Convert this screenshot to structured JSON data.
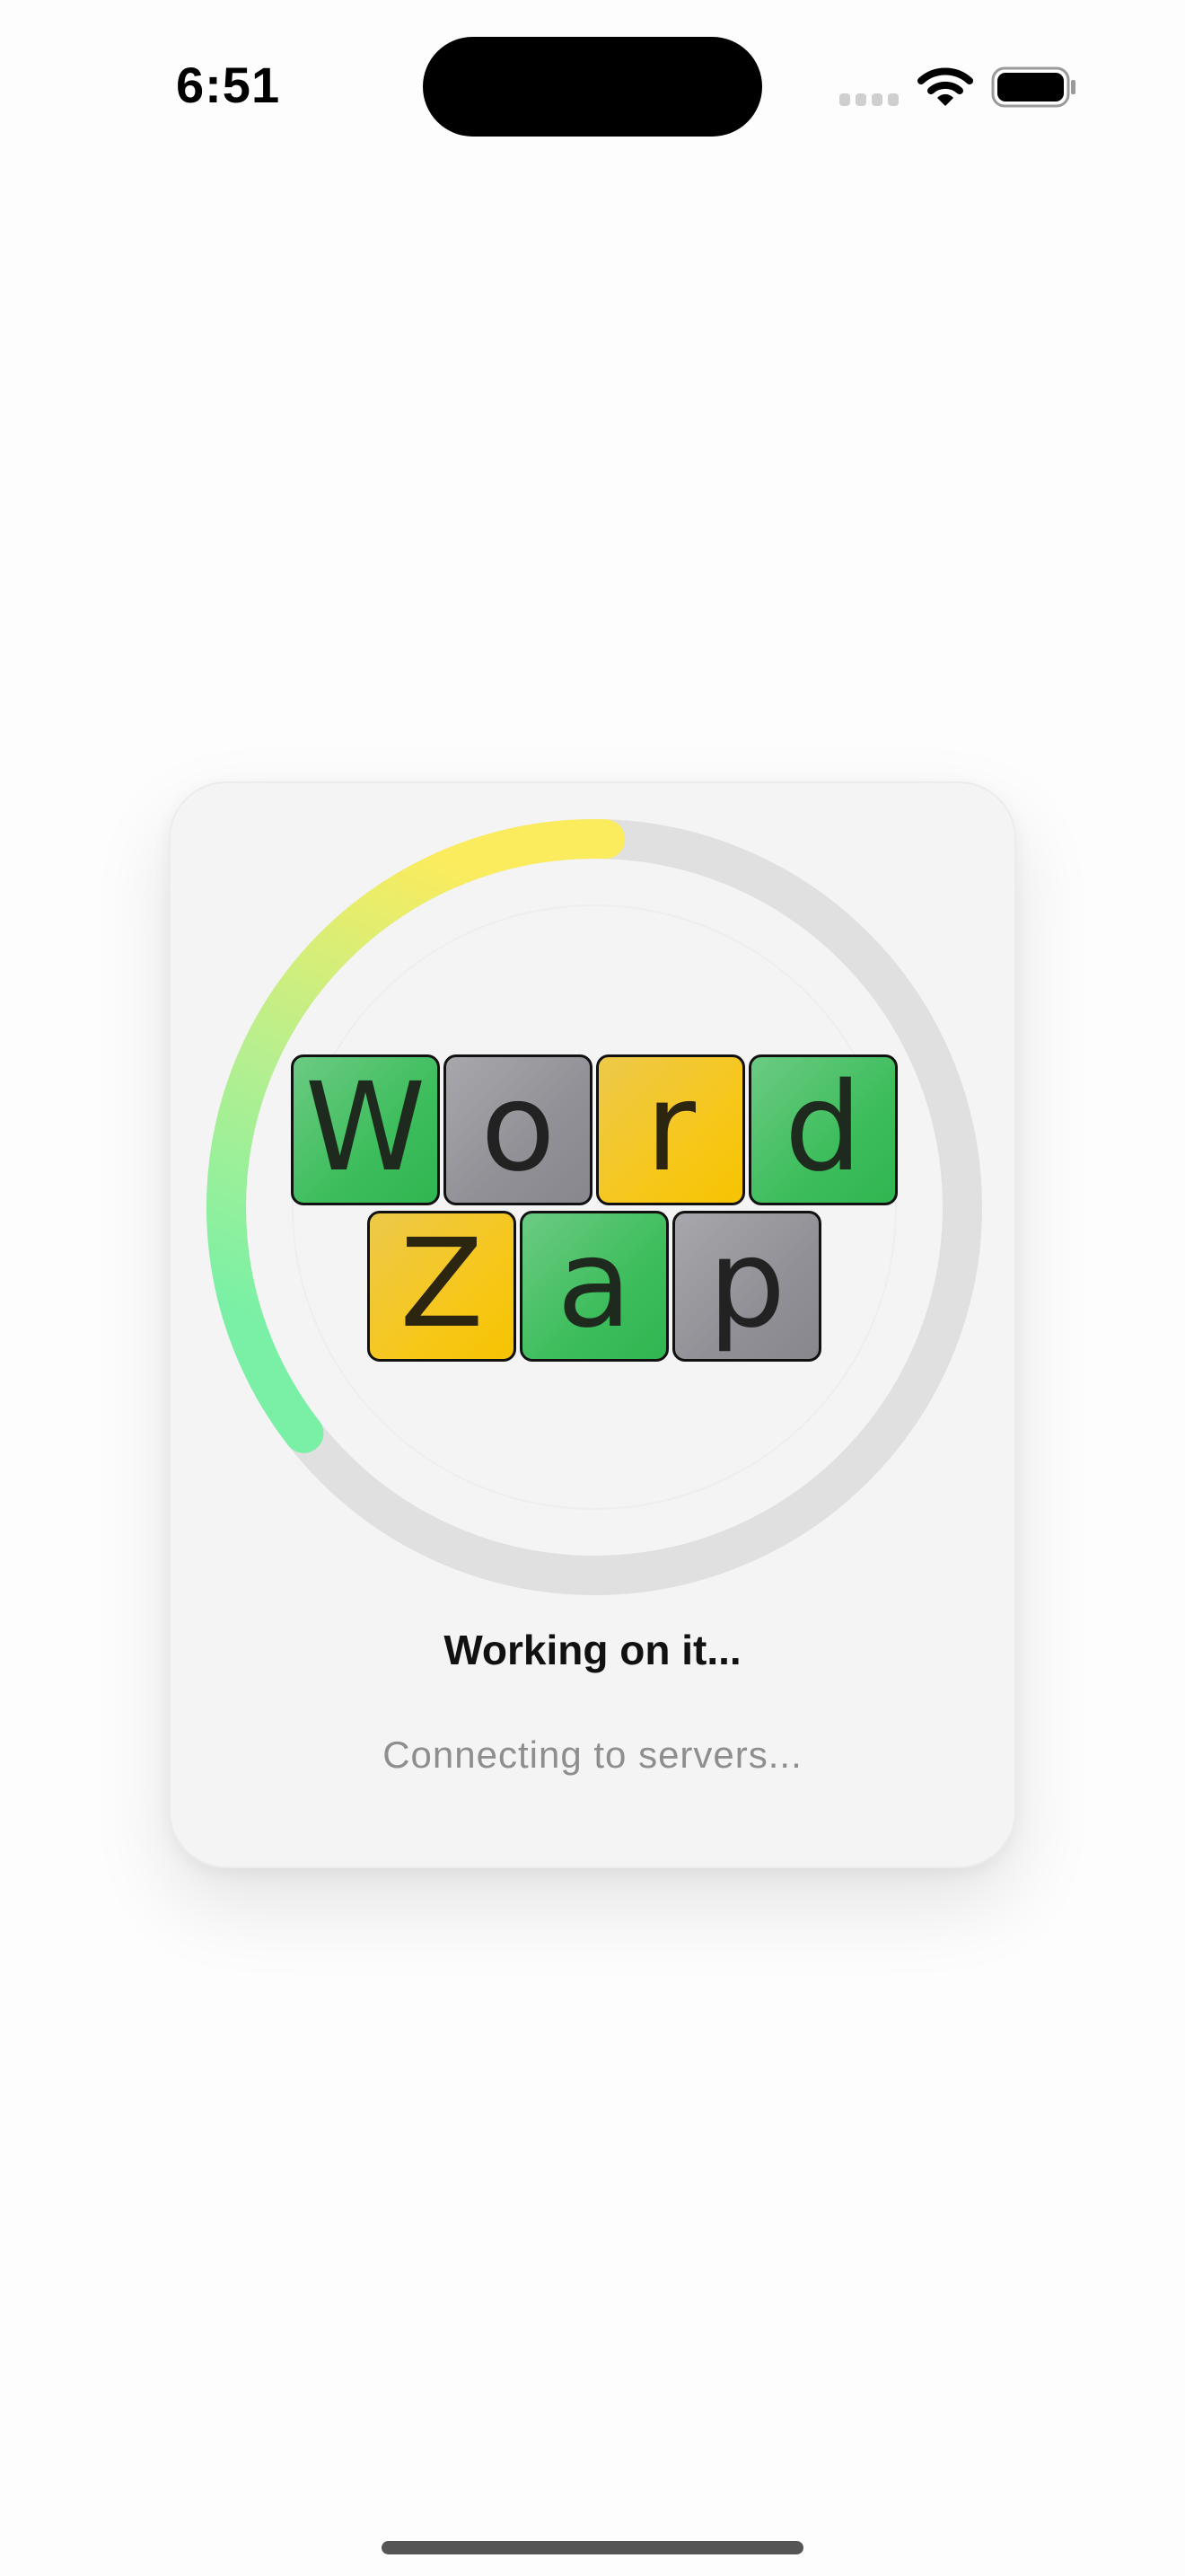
{
  "status_bar": {
    "time": "6:51"
  },
  "loading": {
    "title": "Working on it...",
    "subtitle": "Connecting to servers...",
    "progress": 0.36,
    "colors": {
      "ring_track": "#e0e0e0",
      "gradient_start": "#79f0a6",
      "gradient_mid": "#b8ef8e",
      "gradient_end": "#fbec5d"
    }
  },
  "logo": {
    "row1": [
      {
        "letter": "W",
        "color": "green"
      },
      {
        "letter": "o",
        "color": "gray"
      },
      {
        "letter": "r",
        "color": "yellow"
      },
      {
        "letter": "d",
        "color": "green"
      }
    ],
    "row2": [
      {
        "letter": "Z",
        "color": "yellow"
      },
      {
        "letter": "a",
        "color": "green"
      },
      {
        "letter": "p",
        "color": "gray"
      }
    ]
  }
}
